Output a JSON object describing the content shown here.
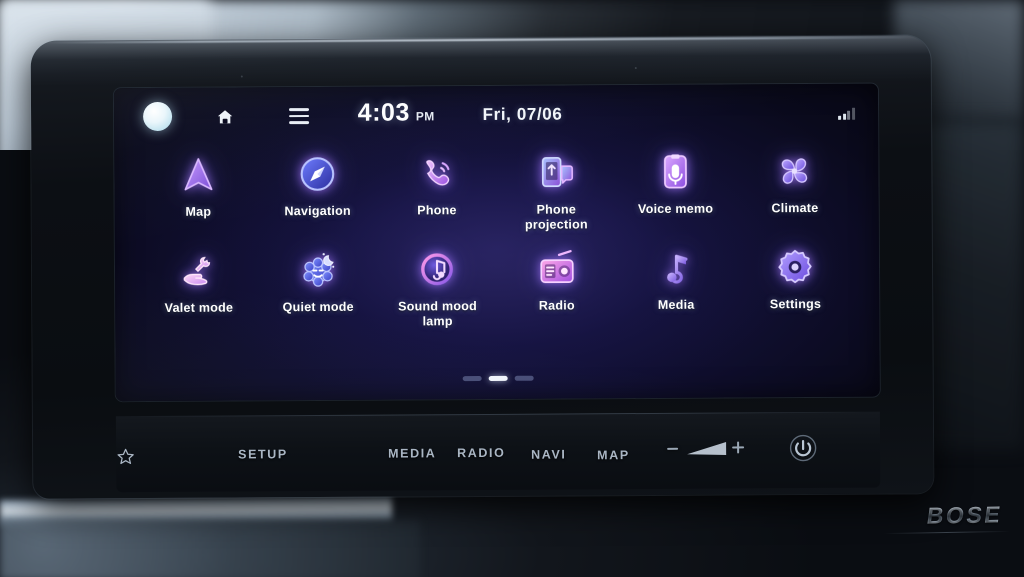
{
  "statusbar": {
    "assistant_icon": "assistant-circle-icon",
    "home_icon": "home-icon",
    "menu_icon": "hamburger-menu-icon",
    "time": "4:03",
    "ampm": "PM",
    "date": "Fri, 07/06",
    "signal_icon": "signal-strength-icon"
  },
  "apps": {
    "row1": [
      {
        "id": "map",
        "label": "Map",
        "icon": "map-arrow-icon",
        "color": "#a86cf0"
      },
      {
        "id": "navigation",
        "label": "Navigation",
        "icon": "compass-icon",
        "color": "#5d6ef5"
      },
      {
        "id": "phone",
        "label": "Phone",
        "icon": "phone-handset-icon",
        "color": "#c87df0"
      },
      {
        "id": "phone-projection",
        "label": "Phone\nprojection",
        "icon": "phone-projection-icon",
        "color": "#9b6ef5"
      },
      {
        "id": "voice-memo",
        "label": "Voice memo",
        "icon": "voice-recorder-icon",
        "color": "#c070f5"
      },
      {
        "id": "climate",
        "label": "Climate",
        "icon": "fan-blades-icon",
        "color": "#8f7cf5"
      }
    ],
    "row2": [
      {
        "id": "valet-mode",
        "label": "Valet mode",
        "icon": "hand-key-icon",
        "color": "#e0a8f0"
      },
      {
        "id": "quiet-mode",
        "label": "Quiet mode",
        "icon": "sleeping-face-icon",
        "color": "#5f7df5"
      },
      {
        "id": "sound-mood-lamp",
        "label": "Sound mood\nlamp",
        "icon": "music-note-circle-icon",
        "color": "#cf7df0"
      },
      {
        "id": "radio",
        "label": "Radio",
        "icon": "radio-receiver-icon",
        "color": "#d276ef"
      },
      {
        "id": "media",
        "label": "Media",
        "icon": "music-note-icon",
        "color": "#9e7ef5"
      },
      {
        "id": "settings",
        "label": "Settings",
        "icon": "gear-icon",
        "color": "#8f6ef5"
      }
    ]
  },
  "pagination": {
    "total": 3,
    "active_index": 1
  },
  "hardkeys": {
    "setup": "SETUP",
    "favorite_icon": "star-icon",
    "media": "MEDIA",
    "radio": "RADIO",
    "navi": "NAVI",
    "map": "MAP",
    "volume_down_icon": "minus-icon",
    "volume_slider_icon": "volume-wedge-icon",
    "volume_up_icon": "plus-icon",
    "power_icon": "power-icon"
  },
  "branding": {
    "audio_system": "BOSE"
  }
}
